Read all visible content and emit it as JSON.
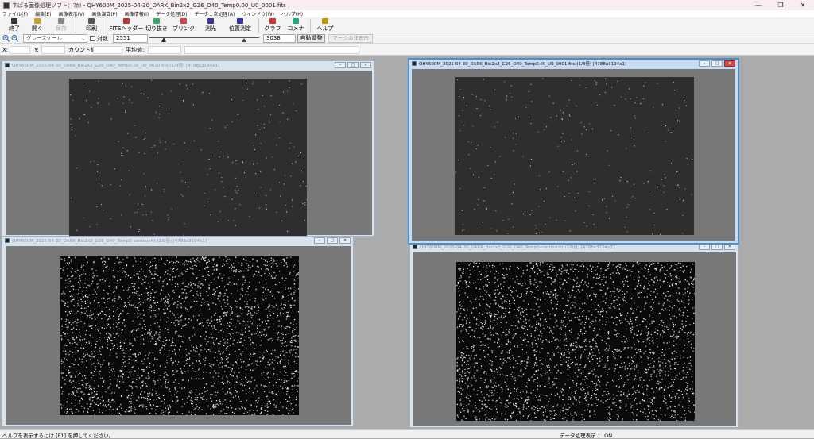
{
  "app": {
    "title": "すばる画像処理ソフト：ﾏｶﾘ - QHY600M_2025-04-30_DARK_Bin2x2_G26_O40_Temp0.00_U0_0001.fits",
    "window_controls": [
      "—",
      "❐",
      "✕"
    ]
  },
  "menu": [
    "ファイル(F)",
    "編集(E)",
    "画像表示(V)",
    "画像演算(P)",
    "画像情報(I)",
    "データ処理(D)",
    "データ１次処理(A)",
    "ウィンドウ(W)",
    "ヘルプ(H)"
  ],
  "toolbar": {
    "buttons": [
      {
        "label": "終了",
        "icon": "power-icon",
        "disabled": false
      },
      {
        "label": "開く",
        "icon": "folder-open-icon",
        "disabled": false
      },
      {
        "label": "保存",
        "icon": "floppy-disk-icon",
        "disabled": true
      },
      {
        "label": "印刷",
        "icon": "printer-icon",
        "disabled": false
      },
      {
        "label": "FITSヘッダー",
        "icon": "fits-header-icon",
        "disabled": false
      },
      {
        "label": "切り抜き",
        "icon": "crop-icon",
        "disabled": false
      },
      {
        "label": "ブリンク",
        "icon": "blink-icon",
        "disabled": false
      },
      {
        "label": "測光",
        "icon": "photometry-icon",
        "disabled": false
      },
      {
        "label": "位置測定",
        "icon": "position-measure-icon",
        "disabled": false
      },
      {
        "label": "グラフ",
        "icon": "graph-icon",
        "disabled": false
      },
      {
        "label": "コメナ",
        "icon": "comment-icon",
        "disabled": false
      },
      {
        "label": "ヘルプ",
        "icon": "help-icon",
        "disabled": false
      }
    ]
  },
  "display": {
    "colormap": "グレースケール",
    "log_label": "対数",
    "log_checked": false,
    "min_value": "2551",
    "max_value": "3038",
    "auto_button": "自動調整",
    "mark_button": "マークの非表示",
    "zoom_in_icon": "zoom-in-icon",
    "zoom_out_icon": "zoom-out-icon"
  },
  "readout": {
    "x_label": "X:",
    "y_label": "Y:",
    "count_label": "カウント値:",
    "avg_label": "平均値:"
  },
  "windows": [
    {
      "title": "QHY600M_2025-04-30_DARK_Bin2x2_G26_O40_Temp0.00_U0_0010.fits (1/8倍) [4788x3194x1]",
      "active": false,
      "kind": "dark"
    },
    {
      "title": "QHY600M_2025-04-30_DARK_Bin2x2_G26_O40_Temp0.00_U0_0001.fits (1/8倍) [4788x3194x1]",
      "active": true,
      "kind": "dark"
    },
    {
      "title": "QHY600M_2025-04-30_DARK_Bin2x2_G26_O40_Temp0-contour.fit (1/8倍) [4788x3194x1]",
      "active": false,
      "kind": "noise"
    },
    {
      "title": "QHY600M_2025-04-30_DARK_Bin2x2_G26_O40_Temp0-contour.fit (1/8倍) [4788x3194x1]",
      "active": false,
      "kind": "noise"
    }
  ],
  "status": {
    "left": "ヘルプを表示するには [F1] を押してください。",
    "right": "データ処理表示 ： ON"
  },
  "colors": {
    "mdi_background": "#ababab",
    "client_background": "#787878",
    "dark_image": "#2e2e2e",
    "noise_image": "#0a0a0a",
    "active_border": "#4a8ed0"
  }
}
